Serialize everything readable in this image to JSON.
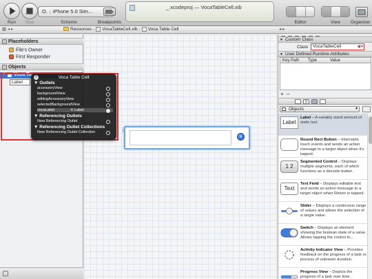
{
  "toolbar": {
    "run_label": "Run",
    "stop_label": "Stop",
    "scheme_label": "Scheme",
    "breakpoints_label": "Breakpoints",
    "editor_label": "Editor",
    "view_label": "View",
    "organizer_label": "Organizer",
    "scheme_target": "O.",
    "scheme_destination": "iPhone 5.0 Sim...",
    "activity_title": "_.xcodeproj — VocaTableCell.xib"
  },
  "jumpbar": {
    "crumbs": [
      "Resources",
      "VocaTableCell.xib",
      "Voca Table Cell"
    ]
  },
  "outline": {
    "placeholders_title": "Placeholders",
    "placeholders": [
      "File's Owner",
      "First Responder"
    ],
    "objects_title": "Objects",
    "selected_object": "Voca Ta",
    "child_object": "Label"
  },
  "hud": {
    "title": "Voca Table Cell",
    "outlets_title": "Outlets",
    "outlets": [
      {
        "name": "accessoryView",
        "connected": false
      },
      {
        "name": "backgroundView",
        "connected": false
      },
      {
        "name": "editingAccessoryView",
        "connected": false
      },
      {
        "name": "selectedBackgroundView",
        "connected": false
      },
      {
        "name": "vocaLabel",
        "target": "Label",
        "connected": true
      }
    ],
    "ref_outlets_title": "Referencing Outlets",
    "ref_outlets": [
      "New Referencing Outlet"
    ],
    "ref_collections_title": "Referencing Outlet Collections",
    "ref_collections": [
      "New Referencing Outlet Collection"
    ]
  },
  "inspector": {
    "custom_class_title": "Custom Class",
    "class_label": "Class",
    "class_value": "VocaTableCell",
    "runtime_attrs_title": "User Defined Runtime Attributes",
    "columns": [
      "Key Path",
      "Type",
      "Value"
    ],
    "library_filter": "Objects",
    "library_items": [
      {
        "name": "Label",
        "icon_text": "Label",
        "desc": " – A variably sized amount of static text.",
        "selected": true
      },
      {
        "name": "Round Rect Button",
        "icon_text": "",
        "desc": " – Intercepts touch events and sends an action message to a target object when it's tapped.",
        "selected": false
      },
      {
        "name": "Segmented Control",
        "icon_text": "1 2",
        "desc": " – Displays multiple segments, each of which functions as a discrete button.",
        "selected": false
      },
      {
        "name": "Text Field",
        "icon_text": "Text",
        "desc": " – Displays editable text and sends an action message to a target object when Return is tapped.",
        "selected": false
      },
      {
        "name": "Slider",
        "icon_text": "",
        "desc": " – Displays a continuous range of values and allows the selection of a single value.",
        "selected": false
      },
      {
        "name": "Switch",
        "icon_text": "",
        "desc": " – Displays an element showing the boolean state of a value. Allows tapping the control to...",
        "selected": false
      },
      {
        "name": "Activity Indicator View",
        "icon_text": "",
        "desc": " – Provides feedback on the progress of a task or process of unknown duration.",
        "selected": false
      },
      {
        "name": "Progress View",
        "icon_text": "",
        "desc": " – Depicts the progress of a task over time.",
        "selected": false
      }
    ]
  },
  "colors": {
    "selection_blue": "#3a73d0",
    "highlight_red": "#e0322e",
    "cell_outline_blue": "#6ea6e7"
  }
}
